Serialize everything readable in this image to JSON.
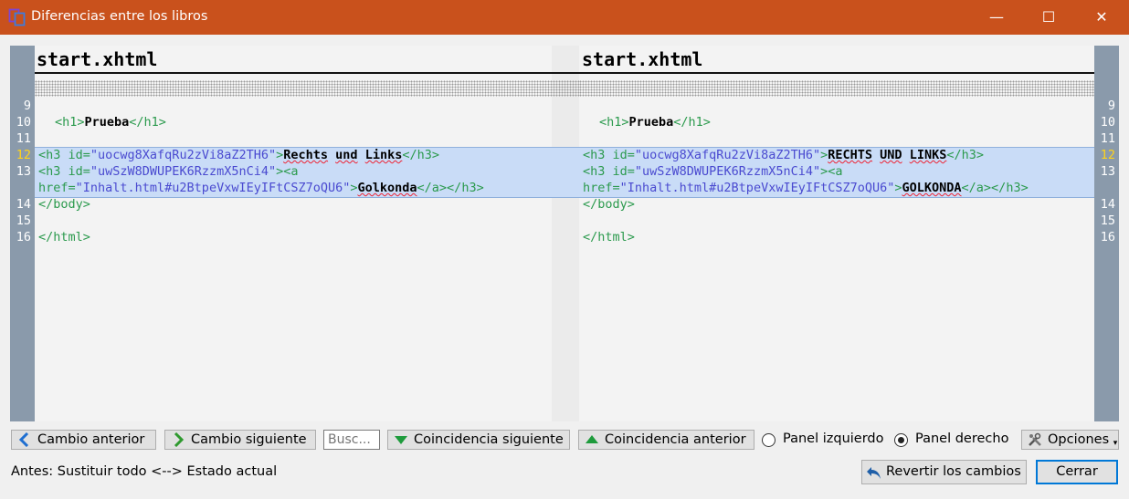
{
  "window": {
    "title": "Diferencias entre los libros",
    "minimize": "—",
    "maximize": "☐",
    "close": "✕"
  },
  "left_pane": {
    "filename": "start.xhtml",
    "line_numbers": [
      "9",
      "10",
      "11",
      "12",
      "13",
      "14",
      "15",
      "16"
    ],
    "lines": {
      "h1_open": "<h1>",
      "h1_text": "Prueba",
      "h1_close": "</h1>",
      "h3a_open": "<h3",
      "h3a_attr": " id=",
      "h3a_val": "\"uocwg8XafqRu2zVi8aZ2TH6\"",
      "h3a_gt": ">",
      "h3a_w1": "Rechts",
      "h3a_w2": "und",
      "h3a_w3": "Links",
      "h3a_close": "</h3>",
      "h3b_open": "<h3",
      "h3b_attr": " id=",
      "h3b_val": "\"uwSzW8DWUPEK6RzzmX5nCi4\"",
      "h3b_gt": "><a",
      "href_attr": "href=",
      "href_val": "\"Inhalt.html#u2BtpeVxwIEyIFtCSZ7oQU6\"",
      "href_gt": ">",
      "link_text": "Golkonda",
      "link_close": "</a></h3>",
      "body_close": "</body>",
      "html_close": "</html>"
    }
  },
  "right_pane": {
    "filename": "start.xhtml",
    "line_numbers": [
      "9",
      "10",
      "11",
      "12",
      "13",
      "14",
      "15",
      "16"
    ],
    "lines": {
      "h1_open": "<h1>",
      "h1_text": "Prueba",
      "h1_close": "</h1>",
      "h3a_open": "<h3",
      "h3a_attr": " id=",
      "h3a_val": "\"uocwg8XafqRu2zVi8aZ2TH6\"",
      "h3a_gt": ">",
      "h3a_w1": "RECHTS",
      "h3a_w2": "UND",
      "h3a_w3": "LINKS",
      "h3a_close": "</h3>",
      "h3b_open": "<h3",
      "h3b_attr": " id=",
      "h3b_val": "\"uwSzW8DWUPEK6RzzmX5nCi4\"",
      "h3b_gt": "><a",
      "href_attr": "href=",
      "href_val": "\"Inhalt.html#u2BtpeVxwIEyIFtCSZ7oQU6\"",
      "href_gt": ">",
      "link_text": "GOLKONDA",
      "link_close": "</a></h3>",
      "body_close": "</body>",
      "html_close": "</html>"
    }
  },
  "toolbar": {
    "prev_change": "Cambio anterior",
    "next_change": "Cambio siguiente",
    "search_placeholder": "Busc...",
    "next_match": "Coincidencia siguiente",
    "prev_match": "Coincidencia anterior",
    "left_panel": "Panel izquierdo",
    "right_panel": "Panel derecho",
    "selected_panel": "Panel derecho",
    "options": "Opciones"
  },
  "status_text": "Antes: Sustituir todo <--> Estado actual",
  "revert_button": "Revertir los cambios",
  "close_button": "Cerrar",
  "colors": {
    "titlebar": "#c9511c",
    "changed_block": "#c9dcf7",
    "gutter": "#8a9aab",
    "highlight_line_number": "#ffd31a"
  }
}
